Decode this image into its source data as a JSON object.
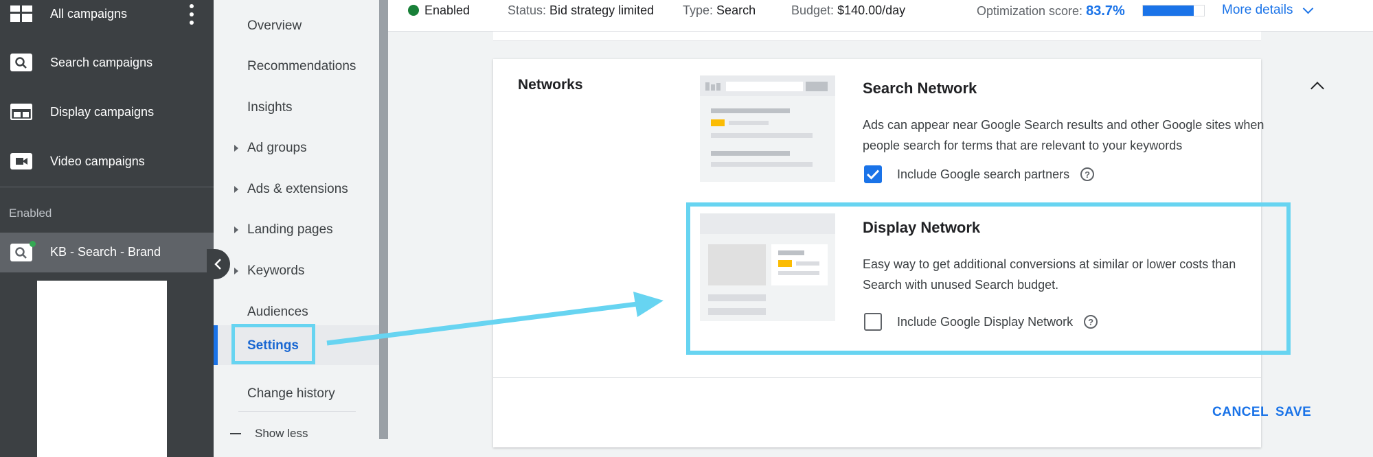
{
  "left_nav": {
    "campaign_types": [
      {
        "label": "All campaigns",
        "icon": "dashboard-icon"
      },
      {
        "label": "Search campaigns",
        "icon": "search-icon"
      },
      {
        "label": "Display campaigns",
        "icon": "display-icon"
      },
      {
        "label": "Video campaigns",
        "icon": "video-icon"
      }
    ],
    "section_label": "Enabled",
    "campaign": {
      "label": "KB - Search - Brand",
      "status_color": "#34a853"
    }
  },
  "sub_menu": {
    "items": [
      {
        "label": "Overview",
        "expandable": false
      },
      {
        "label": "Recommendations",
        "expandable": false
      },
      {
        "label": "Insights",
        "expandable": false
      },
      {
        "label": "Ad groups",
        "expandable": true
      },
      {
        "label": "Ads & extensions",
        "expandable": true
      },
      {
        "label": "Landing pages",
        "expandable": true
      },
      {
        "label": "Keywords",
        "expandable": true
      },
      {
        "label": "Audiences",
        "expandable": false
      },
      {
        "label": "Settings",
        "expandable": false,
        "active": true
      },
      {
        "label": "Change history",
        "expandable": false
      }
    ],
    "show_less": "Show less"
  },
  "status_bar": {
    "enabled": "Enabled",
    "status_label": "Status:",
    "status_value": "Bid strategy limited",
    "type_label": "Type:",
    "type_value": "Search",
    "budget_label": "Budget:",
    "budget_value": "$140.00/day",
    "opt_label": "Optimization score:",
    "opt_value": "83.7%",
    "opt_fraction": 0.837,
    "more_details": "More details"
  },
  "networks": {
    "title": "Networks",
    "search": {
      "title": "Search Network",
      "description": "Ads can appear near Google Search results and other Google sites when people search for terms that are relevant to your keywords",
      "checkbox_label": "Include Google search partners",
      "checked": true
    },
    "display": {
      "title": "Display Network",
      "description": "Easy way to get additional conversions at similar or lower costs than Search with unused Search budget.",
      "checkbox_label": "Include Google Display Network",
      "checked": false
    },
    "cancel": "CANCEL",
    "save": "SAVE"
  },
  "colors": {
    "accent": "#1a73e8",
    "highlight": "#67d4f1",
    "nav_bg": "#3c4043"
  }
}
